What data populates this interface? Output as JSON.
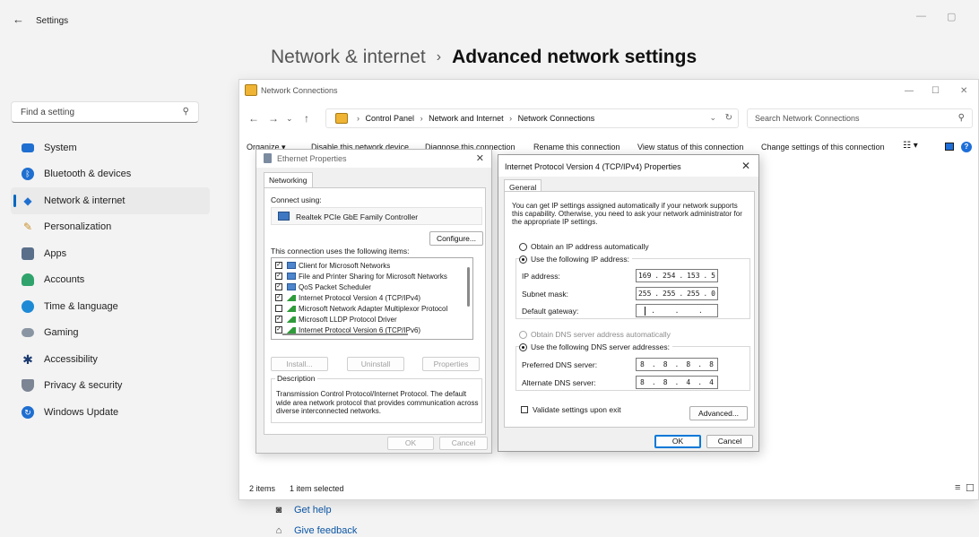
{
  "settings": {
    "title": "Settings",
    "back_icon": "back-arrow-icon",
    "heading_parent": "Network & internet",
    "heading_sep": "›",
    "heading_current": "Advanced network settings",
    "search_placeholder": "Find a setting",
    "nav": [
      {
        "label": "System",
        "icon": "system-icon",
        "color": "#1f6fd0"
      },
      {
        "label": "Bluetooth & devices",
        "icon": "bluetooth-icon",
        "color": "#1f6fd0"
      },
      {
        "label": "Network & internet",
        "icon": "wifi-icon",
        "color": "#1f6fd0",
        "active": true
      },
      {
        "label": "Personalization",
        "icon": "brush-icon",
        "color": "#c9902a"
      },
      {
        "label": "Apps",
        "icon": "apps-icon",
        "color": "#5a6f8a"
      },
      {
        "label": "Accounts",
        "icon": "person-icon",
        "color": "#2fa36b"
      },
      {
        "label": "Time & language",
        "icon": "globe-clock-icon",
        "color": "#1e8ad6"
      },
      {
        "label": "Gaming",
        "icon": "controller-icon",
        "color": "#8a95a3"
      },
      {
        "label": "Accessibility",
        "icon": "accessibility-icon",
        "color": "#1a3a70"
      },
      {
        "label": "Privacy & security",
        "icon": "shield-icon",
        "color": "#7c8594"
      },
      {
        "label": "Windows Update",
        "icon": "update-icon",
        "color": "#1f6fd0"
      }
    ],
    "get_help": "Get help",
    "give_feedback": "Give feedback",
    "accent": "#0067c0"
  },
  "network_connections": {
    "title": "Network Connections",
    "breadcrumb": [
      "Control Panel",
      "Network and Internet",
      "Network Connections"
    ],
    "search_placeholder": "Search Network Connections",
    "commands": {
      "organize": "Organize ▾",
      "disable": "Disable this network device",
      "diagnose": "Diagnose this connection",
      "rename": "Rename this connection",
      "view_status": "View status of this connection",
      "change_settings": "Change settings of this connection"
    },
    "status_items": "2 items",
    "status_selected": "1 item selected"
  },
  "ethernet_properties": {
    "title": "Ethernet Properties",
    "tab": "Networking",
    "connect_using_label": "Connect using:",
    "adapter": "Realtek PCIe GbE Family Controller",
    "configure": "Configure...",
    "items_label": "This connection uses the following items:",
    "items": [
      {
        "label": "Client for Microsoft Networks",
        "checked": true,
        "icon": "network-client-icon"
      },
      {
        "label": "File and Printer Sharing for Microsoft Networks",
        "checked": true,
        "icon": "network-client-icon"
      },
      {
        "label": "QoS Packet Scheduler",
        "checked": true,
        "icon": "network-client-icon"
      },
      {
        "label": "Internet Protocol Version 4 (TCP/IPv4)",
        "checked": true,
        "icon": "protocol-icon"
      },
      {
        "label": "Microsoft Network Adapter Multiplexor Protocol",
        "checked": false,
        "icon": "protocol-icon"
      },
      {
        "label": "Microsoft LLDP Protocol Driver",
        "checked": true,
        "icon": "protocol-icon"
      },
      {
        "label": "Internet Protocol Version 6 (TCP/IPv6)",
        "checked": true,
        "icon": "protocol-icon"
      }
    ],
    "install": "Install...",
    "uninstall": "Uninstall",
    "properties": "Properties",
    "description_legend": "Description",
    "description": "Transmission Control Protocol/Internet Protocol. The default wide area network protocol that provides communication across diverse interconnected networks.",
    "ok": "OK",
    "cancel": "Cancel"
  },
  "ipv4_properties": {
    "title": "Internet Protocol Version 4 (TCP/IPv4) Properties",
    "tab": "General",
    "intro": "You can get IP settings assigned automatically if your network supports this capability. Otherwise, you need to ask your network administrator for the appropriate IP settings.",
    "obtain_ip_auto": "Obtain an IP address automatically",
    "use_following_ip": "Use the following IP address:",
    "ip_address_label": "IP address:",
    "ip_address": [
      "169",
      "254",
      "153",
      "5"
    ],
    "subnet_label": "Subnet mask:",
    "subnet": [
      "255",
      "255",
      "255",
      "0"
    ],
    "gateway_label": "Default gateway:",
    "gateway": [
      "",
      "",
      "",
      ""
    ],
    "obtain_dns_auto": "Obtain DNS server address automatically",
    "use_following_dns": "Use the following DNS server addresses:",
    "preferred_dns_label": "Preferred DNS server:",
    "preferred_dns": [
      "8",
      "8",
      "8",
      "8"
    ],
    "alternate_dns_label": "Alternate DNS server:",
    "alternate_dns": [
      "8",
      "8",
      "4",
      "4"
    ],
    "validate_label": "Validate settings upon exit",
    "advanced": "Advanced...",
    "ok": "OK",
    "cancel": "Cancel"
  }
}
